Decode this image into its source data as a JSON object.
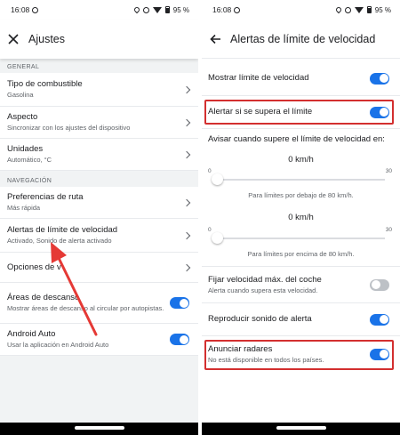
{
  "left": {
    "status": {
      "time": "16:08",
      "battery": "95 %"
    },
    "appbar": {
      "title": "Ajustes"
    },
    "sections": [
      {
        "header": "GENERAL",
        "items": [
          {
            "label": "Tipo de combustible",
            "sub": "Gasolina",
            "control": "chevron"
          },
          {
            "label": "Aspecto",
            "sub": "Sincronizar con los ajustes del dispositivo",
            "control": "chevron"
          },
          {
            "label": "Unidades",
            "sub": "Automático, °C",
            "control": "chevron"
          }
        ]
      },
      {
        "header": "NAVEGACIÓN",
        "items": [
          {
            "label": "Preferencias de ruta",
            "sub": "Más rápida",
            "control": "chevron"
          },
          {
            "label": "Alertas de límite de velocidad",
            "sub": "Activado, Sonido de alerta activado",
            "control": "chevron"
          },
          {
            "label": "Opciones de v",
            "sub": "",
            "control": "chevron"
          },
          {
            "label": "Áreas de descanso",
            "sub": "Mostrar áreas de descanso al circular por autopistas.",
            "control": "toggle",
            "on": true
          },
          {
            "label": "Android Auto",
            "sub": "Usar la aplicación en Android Auto",
            "control": "toggle",
            "on": true
          }
        ]
      }
    ]
  },
  "right": {
    "status": {
      "time": "16:08",
      "battery": "95 %"
    },
    "appbar": {
      "title": "Alertas de límite de velocidad"
    },
    "show_limit": {
      "label": "Mostrar límite de velocidad",
      "on": true
    },
    "alert_exceed": {
      "label": "Alertar si se supera el límite",
      "on": true
    },
    "warn_heading": "Avisar cuando supere el límite de velocidad en:",
    "slider_below": {
      "value": "0 km/h",
      "min": "0",
      "max": "30",
      "caption": "Para límites por debajo de 80 km/h."
    },
    "slider_above": {
      "value": "0 km/h",
      "min": "0",
      "max": "30",
      "caption": "Para límites por encima de 80 km/h."
    },
    "max_speed": {
      "label": "Fijar velocidad máx. del coche",
      "sub": "Alerta cuando supera esta velocidad.",
      "on": false
    },
    "sound": {
      "label": "Reproducir sonido de alerta",
      "on": true
    },
    "radars": {
      "label": "Anunciar radares",
      "sub": "No está disponible en todos los países.",
      "on": true
    }
  },
  "colors": {
    "accent": "#1a73e8",
    "highlight": "#d32f2f",
    "toggle_off": "#bdc1c6"
  },
  "icons": {
    "close": "close-icon",
    "back": "arrow-back-icon",
    "chevron": "chevron-right-icon"
  }
}
